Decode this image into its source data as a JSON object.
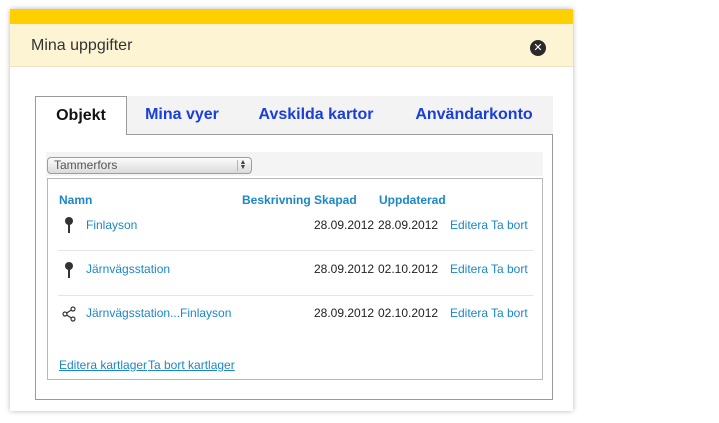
{
  "dialog": {
    "title": "Mina uppgifter",
    "close_icon": "close-icon"
  },
  "tabs": [
    {
      "label": "Objekt",
      "active": true
    },
    {
      "label": "Mina vyer",
      "active": false
    },
    {
      "label": "Avskilda kartor",
      "active": false
    },
    {
      "label": "Användarkonto",
      "active": false
    }
  ],
  "layer_select": {
    "selected": "Tammerfors"
  },
  "table": {
    "columns": [
      "Namn",
      "Beskrivning",
      "Skapad",
      "Uppdaterad"
    ],
    "rows": [
      {
        "icon": "map-pin-icon",
        "name": "Finlayson",
        "description": "",
        "created": "28.09.2012",
        "updated": "28.09.2012",
        "edit": "Editera",
        "delete": "Ta bort"
      },
      {
        "icon": "map-pin-icon",
        "name": "Järnvägsstation",
        "description": "",
        "created": "28.09.2012",
        "updated": "02.10.2012",
        "edit": "Editera",
        "delete": "Ta bort"
      },
      {
        "icon": "route-icon",
        "name": "Järnvägsstation...Finlayson",
        "description": "",
        "created": "28.09.2012",
        "updated": "02.10.2012",
        "edit": "Editera",
        "delete": "Ta bort"
      }
    ]
  },
  "footer_links": {
    "edit_layer": "Editera kartlager",
    "delete_layer": "Ta bort kartlager"
  },
  "colors": {
    "accent_bar": "#ffd000",
    "header_bg": "#fdf4d3",
    "link": "#1b87c9",
    "tab_link": "#1a3fd8"
  }
}
